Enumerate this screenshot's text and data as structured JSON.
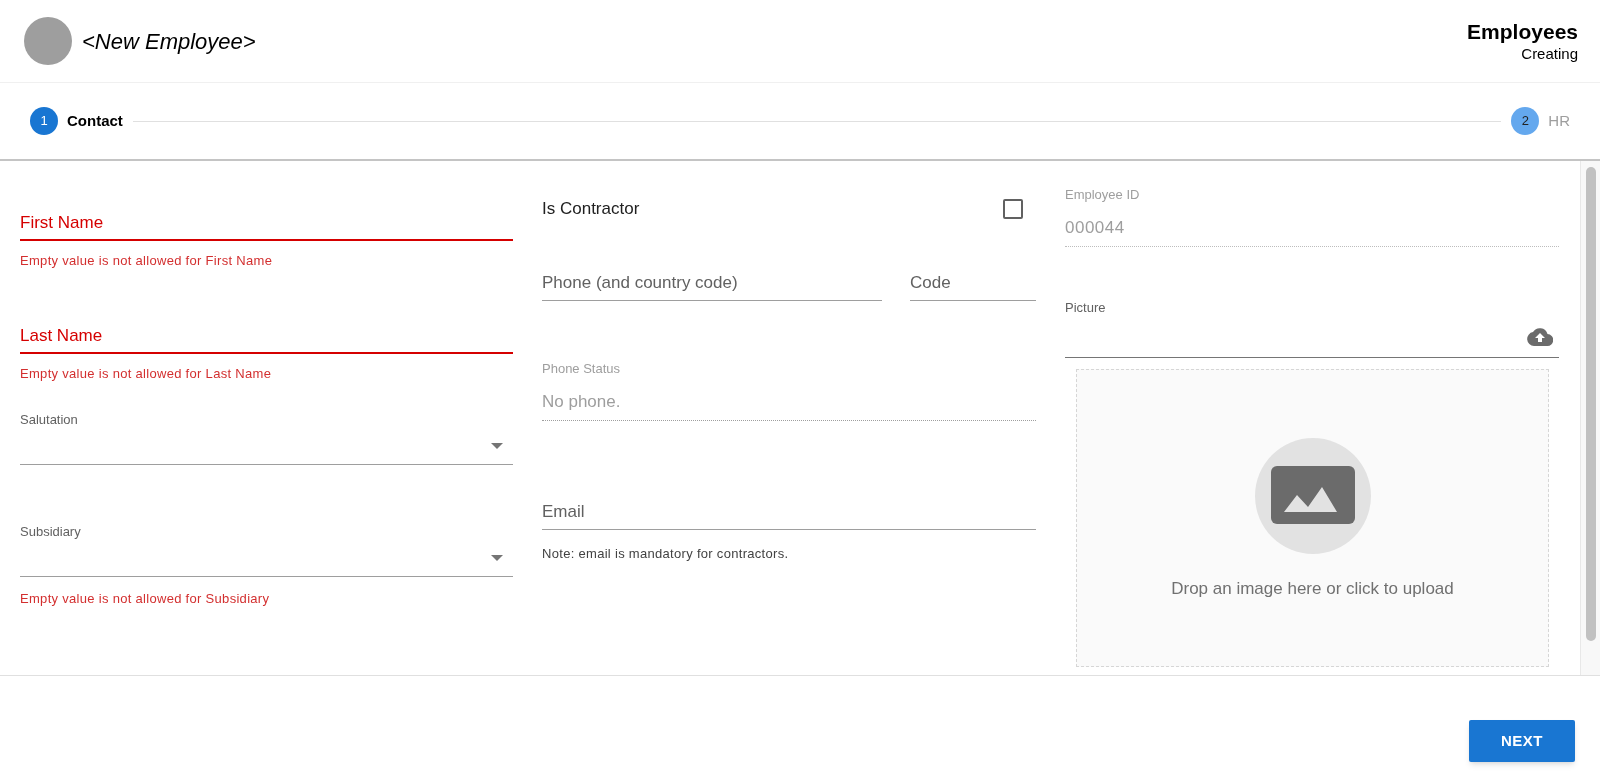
{
  "header": {
    "title": "<New Employee>",
    "module": "Employees",
    "mode": "Creating"
  },
  "steps": [
    {
      "number": "1",
      "label": "Contact",
      "selected": true
    },
    {
      "number": "2",
      "label": "HR",
      "selected": false
    }
  ],
  "left_fields": [
    {
      "kind": "text",
      "placeholder": "First Name",
      "invalid": true,
      "error": "Empty value is not allowed for First Name"
    },
    {
      "kind": "text",
      "placeholder": "Last Name",
      "invalid": true,
      "error": "Empty value is not allowed for Last Name"
    },
    {
      "kind": "select",
      "label": "Salutation"
    },
    {
      "kind": "select",
      "label": "Subsidiary",
      "error": "Empty value is not allowed for Subsidiary"
    }
  ],
  "is_contractor": {
    "label": "Is Contractor",
    "checked": false
  },
  "phone": {
    "placeholder": "Phone (and country code)"
  },
  "code": {
    "placeholder": "Code"
  },
  "phone_status": {
    "label": "Phone Status",
    "value": "No phone."
  },
  "email": {
    "placeholder": "Email",
    "note": "Note: email is mandatory for contractors."
  },
  "employee_id": {
    "label": "Employee ID",
    "value": "000044"
  },
  "picture": {
    "label": "Picture"
  },
  "dropzone": {
    "text": "Drop an image here or click to upload"
  },
  "next_button": "NEXT"
}
